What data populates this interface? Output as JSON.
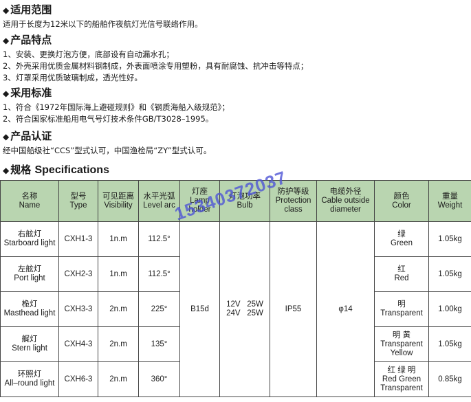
{
  "sections": [
    {
      "heading": "适用范围",
      "lines": [
        "适用于长度为12米以下的船舶作夜航灯光信号联络作用。"
      ]
    },
    {
      "heading": "产品特点",
      "lines": [
        "1、安装、更换灯泡方便，底部设有自动漏水孔；",
        "2、外壳采用优质金属材料钢制成，外表面喷涂专用塑粉，具有耐腐蚀、抗冲击等特点；",
        "3、灯罩采用优质玻璃制成，透光性好。"
      ]
    },
    {
      "heading": "采用标准",
      "lines": [
        "1、符合《1972年国际海上避碰规则》和《钢质海船入级规范》；",
        "2、符合国家标准船用电气号灯技术条件GB/T3028–1995。"
      ]
    },
    {
      "heading": "产品认证",
      "lines": [
        "经中国船级社“CCS”型式认可，中国渔检局“ZY”型式认可。"
      ]
    }
  ],
  "spec": {
    "heading_cn": "规格",
    "heading_en": "Specifications",
    "headers": [
      {
        "cn": "名称",
        "en": "Name"
      },
      {
        "cn": "型号",
        "en": "Type"
      },
      {
        "cn": "可见距离",
        "en": "Visibility"
      },
      {
        "cn": "水平光弧",
        "en": "Level arc"
      },
      {
        "cn": "灯座",
        "en": "Lamp holder"
      },
      {
        "cn": "灯泡功率",
        "en": "Bulb"
      },
      {
        "cn": "防护等级",
        "en": "Protection class"
      },
      {
        "cn": "电缆外径",
        "en": "Cable outside diameter"
      },
      {
        "cn": "颜色",
        "en": "Color"
      },
      {
        "cn": "重量",
        "en": "Weight"
      }
    ],
    "rows": [
      {
        "name_cn": "右舷灯",
        "name_en": "Starboard light",
        "type": "CXH1-3",
        "visibility": "1n.m",
        "arc": "112.5°",
        "color_cn": "绿",
        "color_en": "Green",
        "weight": "1.05kg"
      },
      {
        "name_cn": "左舷灯",
        "name_en": "Port light",
        "type": "CXH2-3",
        "visibility": "1n.m",
        "arc": "112.5°",
        "color_cn": "红",
        "color_en": "Red",
        "weight": "1.05kg"
      },
      {
        "name_cn": "桅灯",
        "name_en": "Masthead light",
        "type": "CXH3-3",
        "visibility": "2n.m",
        "arc": "225°",
        "color_cn": "明",
        "color_en": "Transparent",
        "weight": "1.00kg"
      },
      {
        "name_cn": "艉灯",
        "name_en": "Stern light",
        "type": "CXH4-3",
        "visibility": "2n.m",
        "arc": "135°",
        "color_cn": "明 黄",
        "color_en": "Transparent Yellow",
        "weight": "1.05kg"
      },
      {
        "name_cn": "环照灯",
        "name_en": "All–round light",
        "type": "CXH6-3",
        "visibility": "2n.m",
        "arc": "360°",
        "color_cn": "红 绿 明",
        "color_en": "Red Green Transparent",
        "weight": "0.85kg"
      }
    ],
    "shared": {
      "lamp_holder": "B15d",
      "bulb_line1": "12V   25W",
      "bulb_line2": "24V   25W",
      "protection": "IP55",
      "cable": "φ14"
    }
  },
  "watermark": "15340372037"
}
